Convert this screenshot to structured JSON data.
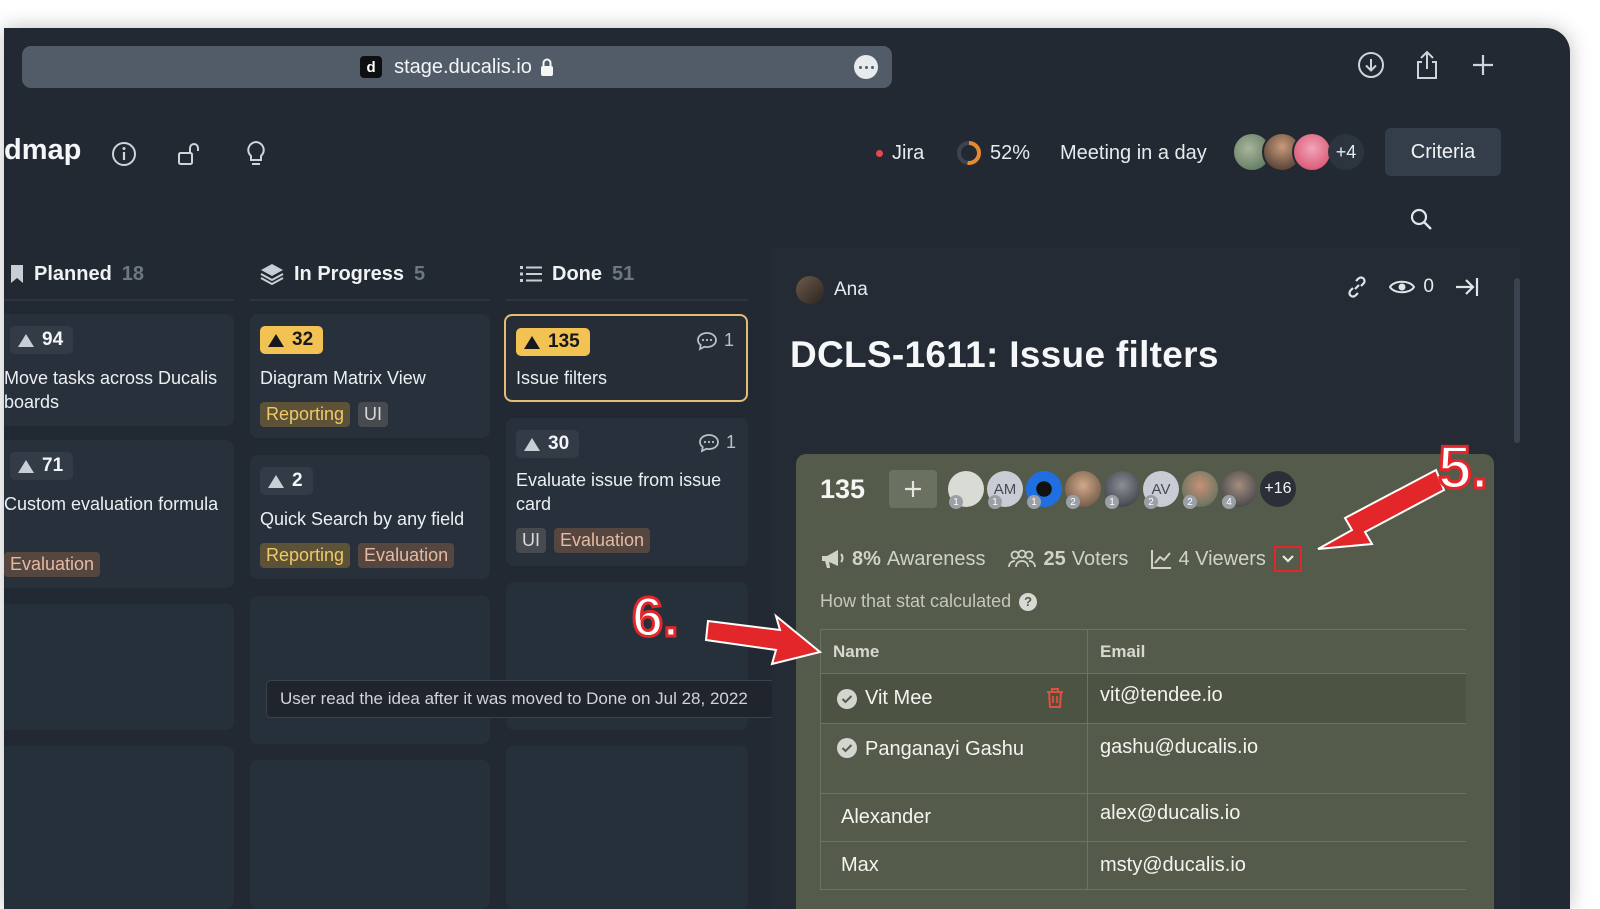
{
  "browser": {
    "url": "stage.ducalis.io",
    "favicon": "d"
  },
  "topbar": {
    "title": "dmap",
    "jira": "Jira",
    "progress": "52%",
    "progress_fraction": 0.52,
    "meeting": "Meeting in a day",
    "team_more": "+4",
    "criteria": "Criteria"
  },
  "columns": [
    {
      "name": "Planned",
      "count": "18"
    },
    {
      "name": "In Progress",
      "count": "5"
    },
    {
      "name": "Done",
      "count": "51"
    }
  ],
  "cards": {
    "planned": [
      {
        "score": "94",
        "title": "Move tasks across Ducalis boards"
      },
      {
        "score": "71",
        "title": "Custom evaluation formula",
        "tags": [
          "Evaluation"
        ]
      }
    ],
    "in_progress": [
      {
        "score": "32",
        "title": "Diagram Matrix View",
        "tags": [
          "Reporting",
          "UI"
        ]
      },
      {
        "score": "2",
        "title": "Quick Search by any field",
        "tags": [
          "Reporting",
          "Evaluation"
        ]
      }
    ],
    "done": [
      {
        "score": "135",
        "title": "Issue filters",
        "comments": "1"
      },
      {
        "score": "30",
        "title": "Evaluate issue from issue card",
        "comments": "1",
        "tags": [
          "UI",
          "Evaluation"
        ]
      }
    ]
  },
  "tooltip": "User read the idea after it was moved to Done on Jul 28, 2022",
  "panel": {
    "author": "Ana",
    "viewers_count": "0",
    "title": "DCLS-1611: Issue filters",
    "score": "135",
    "voters": [
      {
        "initials": "",
        "badge": "1"
      },
      {
        "initials": "AM",
        "badge": "1"
      },
      {
        "initials": "",
        "badge": "1"
      },
      {
        "initials": "",
        "badge": "2"
      },
      {
        "initials": "",
        "badge": "1"
      },
      {
        "initials": "AV",
        "badge": "2"
      },
      {
        "initials": "",
        "badge": "2"
      },
      {
        "initials": "",
        "badge": "4"
      }
    ],
    "voters_more": "+16",
    "awareness": "8%",
    "awareness_label": "Awareness",
    "voters_count": "25",
    "voters_label": "Voters",
    "viewers": "4 Viewers",
    "how_stat": "How that stat calculated",
    "table": {
      "headers": [
        "Name",
        "Email"
      ],
      "rows": [
        {
          "name": "Vit Mee",
          "email": "vit@tendee.io",
          "read": true
        },
        {
          "name": "Panganayi Gashu",
          "email": "gashu@ducalis.io",
          "read": true
        },
        {
          "name": "Alexander",
          "email": "alex@ducalis.io",
          "read": false
        },
        {
          "name": "Max",
          "email": "msty@ducalis.io",
          "read": false
        }
      ]
    }
  },
  "annotations": {
    "marker5": "5.",
    "marker6": "6."
  },
  "colors": {
    "accent_yellow": "#f2c253",
    "annotation_red": "#e3262a",
    "vote_panel": "#545b4a"
  }
}
